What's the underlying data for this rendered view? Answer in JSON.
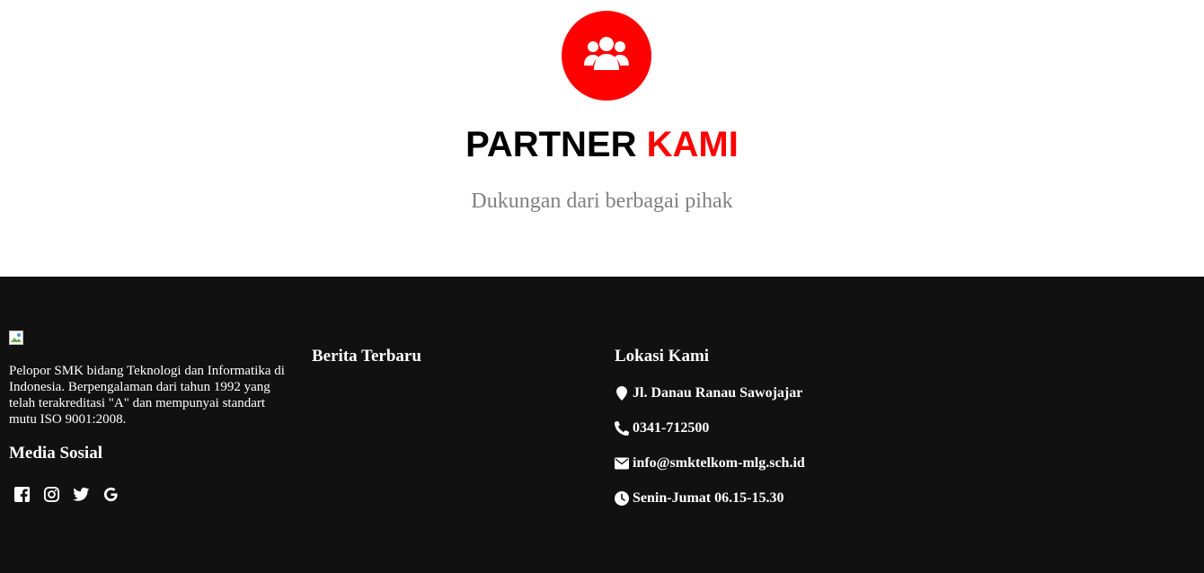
{
  "partner": {
    "icon": "users-icon",
    "title_main": "PARTNER",
    "title_accent": "KAMI",
    "subtitle": "Dukungan dari berbagai pihak",
    "accent_color": "#ff0000"
  },
  "footer": {
    "background": "#111111",
    "about_text": "Pelopor SMK bidang Teknologi dan Informatika di Indonesia. Berpengalaman dari tahun 1992 yang telah terakreditasi \"A\" dan mempunyai standart mutu ISO 9001:2008.",
    "social_heading": "Media Sosial",
    "socials": [
      "facebook-icon",
      "instagram-icon",
      "twitter-icon",
      "google-icon"
    ],
    "news_heading": "Berita Terbaru",
    "location_heading": "Lokasi Kami",
    "address": "Jl. Danau Ranau Sawojajar",
    "phone": "0341-712500",
    "email": "info@smktelkom-mlg.sch.id",
    "hours": "Senin-Jumat 06.15-15.30"
  }
}
